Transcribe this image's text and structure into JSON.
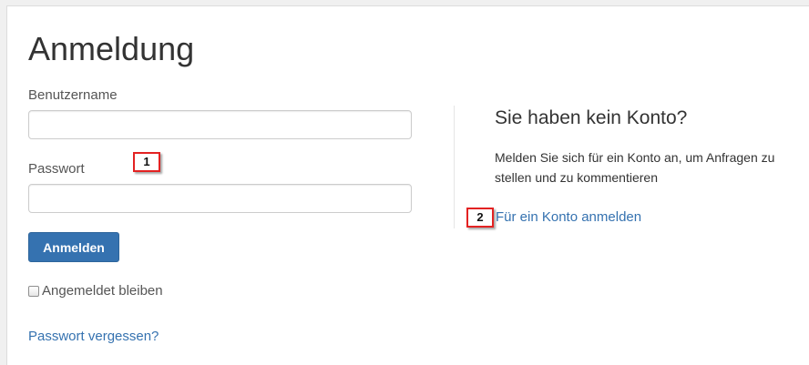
{
  "page": {
    "title": "Anmeldung"
  },
  "login": {
    "username_label": "Benutzername",
    "username_value": "",
    "password_label": "Passwort",
    "password_value": "",
    "submit_label": "Anmelden",
    "remember_label": "Angemeldet bleiben",
    "remember_checked": false,
    "forgot_link": "Passwort vergessen?"
  },
  "signup": {
    "heading": "Sie haben kein Konto?",
    "description": "Melden Sie sich für ein Konto an, um Anfragen zu stellen und zu kommentieren",
    "link": "Für ein Konto anmelden"
  },
  "annotations": {
    "marker_1": "1",
    "marker_2": "2",
    "marker_color": "#e32222"
  },
  "colors": {
    "primary": "#3572b0",
    "link": "#3572b0"
  }
}
